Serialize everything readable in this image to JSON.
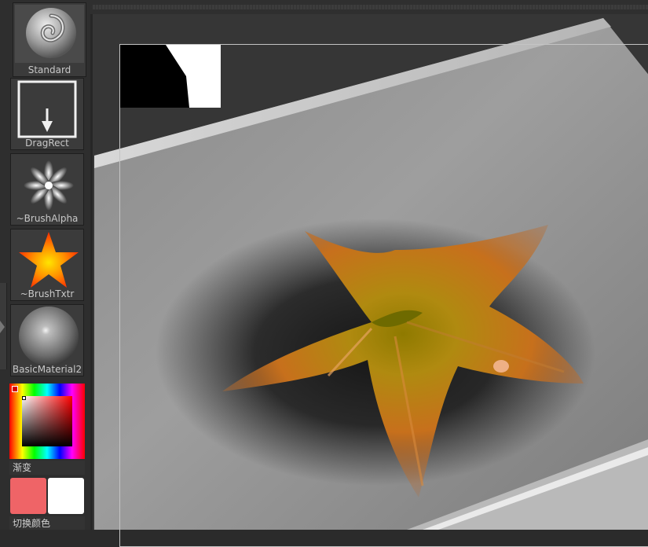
{
  "shelf": {
    "brush_label": "Standard",
    "stroke_label": "DragRect",
    "alpha_label": "~BrushAlpha",
    "texture_label": "~BrushTxtr",
    "material_label": "BasicMaterial2",
    "gradient_label": "渐变",
    "switch_color_label": "切换颜色"
  },
  "colors": {
    "main_color": "#ef6467",
    "secondary_color": "#ffffff",
    "picker_selected": "#d40000"
  },
  "icons": {
    "brush": "standard-brush-sphere-icon",
    "stroke": "drag-rect-arrow-icon",
    "alpha": "radial-flower-alpha-icon",
    "texture": "orange-star-texture-icon",
    "material": "gray-sphere-material-icon"
  }
}
